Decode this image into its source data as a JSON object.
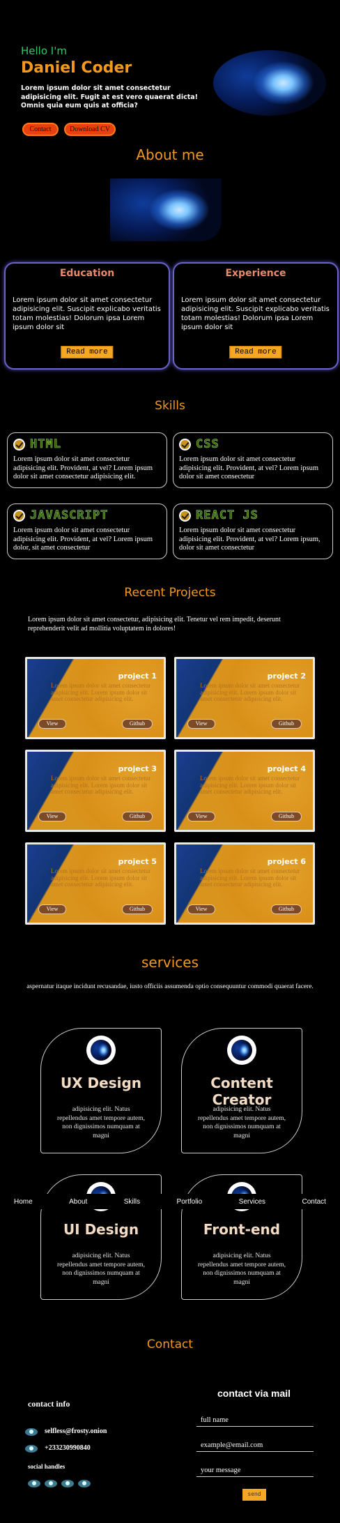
{
  "hero": {
    "greeting": "Hello I'm",
    "name": "Daniel Coder",
    "description": "Lorem ipsum dolor sit amet consectetur adipisicing elit. Fugit at est vero quaerat dicta! Omnis quia eum quis at officia?",
    "contact_button": "Contact",
    "cv_button": "Download CV"
  },
  "about": {
    "title": "About me",
    "cards": [
      {
        "title": "Education",
        "text": "Lorem ipsum dolor sit amet consectetur adipisicing elit. Suscipit explicabo veritatis totam molestias! Dolorum ipsa Lorem ipsum dolor sit",
        "button": "Read more"
      },
      {
        "title": "Experience",
        "text": "Lorem ipsum dolor sit amet consectetur adipisicing elit. Suscipit explicabo veritatis totam molestias! Dolorum ipsa Lorem ipsum dolor sit",
        "button": "Read more"
      }
    ]
  },
  "skills": {
    "title": "Skills",
    "items": [
      {
        "name": "HTML",
        "text": "Lorem ipsum dolor sit amet consectetur adipisicing elit. Provident, at vel? Lorem ipsum dolor sit amet consectetur adipisicing elit."
      },
      {
        "name": "CSS",
        "text": "Lorem ipsum dolor sit amet consectetur adipisicing elit. Provident, at vel? Lorem ipsum dolor sit amet consectetur"
      },
      {
        "name": "JAVASCRIPT",
        "text": "Lorem ipsum dolor sit amet consectetur adipisicing elit. Provident, at vel? Lorem ipsum dolor, sit amet consectetur"
      },
      {
        "name": "REACT JS",
        "text": "Lorem ipsum dolor sit amet consectetur adipisicing elit. Provident, at vel? Lorem ipsum, dolor sit amet consectetur"
      }
    ]
  },
  "projects": {
    "title": "Recent Projects",
    "intro": "Lorem ipsum dolor sit amet consectetur, adipisicing elit. Tenetur vel rem impedit, deserunt reprehenderit velit ad mollitia voluptatem in dolores!",
    "view_label": "View",
    "github_label": "Github",
    "card_text": "Lorem ipsum dolor sit amet consectetur adipisicing elit. Lorem ipsum dolor sit amet consectetur adipisicing elit.",
    "items": [
      "project 1",
      "project 2",
      "project 3",
      "project 4",
      "project 5",
      "project 6"
    ]
  },
  "services": {
    "title": "services",
    "intro": "aspernatur itaque incidunt recusandae, iusto officiis assumenda optio consequuntur commodi quaerat facere.",
    "items": [
      {
        "title": "UX Design",
        "text": "adipisicing elit. Natus repellendus amet tempore autem, non dignissimos numquam at magni"
      },
      {
        "title": "Content Creator",
        "text": "adipisicing elit. Natus repellendus amet tempore autem, non dignissimos numquam at magni"
      },
      {
        "title": "UI Design",
        "text": "adipisicing elit. Natus repellendus amet tempore autem, non dignissimos numquam at magni"
      },
      {
        "title": "Front-end",
        "text": "adipisicing elit. Natus repellendus amet tempore autem, non dignissimos numquam at magni"
      }
    ]
  },
  "nav": [
    "Home",
    "About",
    "Skills",
    "Portfolio",
    "Services",
    "Contact"
  ],
  "contact": {
    "title": "Contact",
    "info_title": "contact info",
    "email": "selfless@frosty.onion",
    "phone": "+233230990840",
    "social_title": "social handles",
    "form_title": "contact via mail",
    "fullname_placeholder": "full name",
    "email_placeholder": "example@email.com",
    "message_placeholder": "your message",
    "send_label": "send"
  },
  "colors": {
    "accent": "#f39a1e",
    "green": "#35c46a",
    "button": "#e8410f",
    "border_purple": "#6a63c9"
  }
}
